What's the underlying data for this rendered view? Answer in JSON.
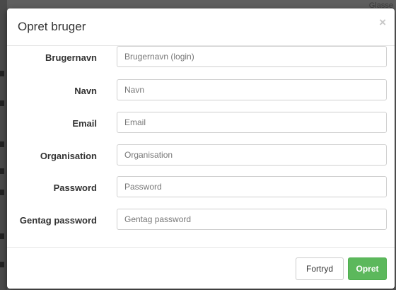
{
  "background": {
    "corner_text": "Glasse"
  },
  "modal": {
    "title": "Opret bruger",
    "close_symbol": "×"
  },
  "form": {
    "fields": [
      {
        "label": "Brugernavn",
        "placeholder": "Brugernavn (login)",
        "value": ""
      },
      {
        "label": "Navn",
        "placeholder": "Navn",
        "value": ""
      },
      {
        "label": "Email",
        "placeholder": "Email",
        "value": ""
      },
      {
        "label": "Organisation",
        "placeholder": "Organisation",
        "value": ""
      },
      {
        "label": "Password",
        "placeholder": "Password",
        "value": ""
      },
      {
        "label": "Gentag password",
        "placeholder": "Gentag password",
        "value": ""
      }
    ]
  },
  "footer": {
    "cancel_label": "Fortryd",
    "submit_label": "Opret"
  },
  "colors": {
    "submit_bg": "#5cb85c",
    "overlay": "#6f6f6f"
  }
}
